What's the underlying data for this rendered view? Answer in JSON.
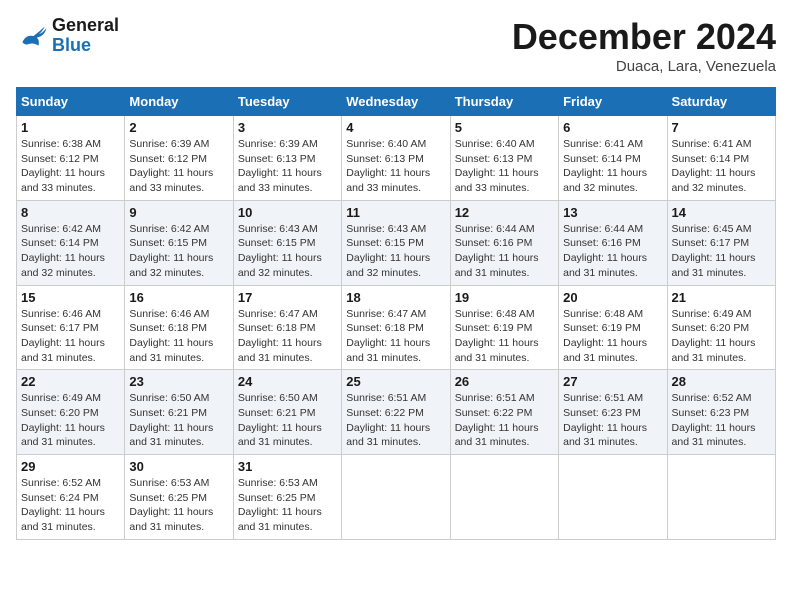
{
  "header": {
    "logo_line1": "General",
    "logo_line2": "Blue",
    "month_title": "December 2024",
    "subtitle": "Duaca, Lara, Venezuela"
  },
  "weekdays": [
    "Sunday",
    "Monday",
    "Tuesday",
    "Wednesday",
    "Thursday",
    "Friday",
    "Saturday"
  ],
  "weeks": [
    [
      {
        "day": "1",
        "sunrise": "6:38 AM",
        "sunset": "6:12 PM",
        "daylight": "11 hours and 33 minutes."
      },
      {
        "day": "2",
        "sunrise": "6:39 AM",
        "sunset": "6:12 PM",
        "daylight": "11 hours and 33 minutes."
      },
      {
        "day": "3",
        "sunrise": "6:39 AM",
        "sunset": "6:13 PM",
        "daylight": "11 hours and 33 minutes."
      },
      {
        "day": "4",
        "sunrise": "6:40 AM",
        "sunset": "6:13 PM",
        "daylight": "11 hours and 33 minutes."
      },
      {
        "day": "5",
        "sunrise": "6:40 AM",
        "sunset": "6:13 PM",
        "daylight": "11 hours and 33 minutes."
      },
      {
        "day": "6",
        "sunrise": "6:41 AM",
        "sunset": "6:14 PM",
        "daylight": "11 hours and 32 minutes."
      },
      {
        "day": "7",
        "sunrise": "6:41 AM",
        "sunset": "6:14 PM",
        "daylight": "11 hours and 32 minutes."
      }
    ],
    [
      {
        "day": "8",
        "sunrise": "6:42 AM",
        "sunset": "6:14 PM",
        "daylight": "11 hours and 32 minutes."
      },
      {
        "day": "9",
        "sunrise": "6:42 AM",
        "sunset": "6:15 PM",
        "daylight": "11 hours and 32 minutes."
      },
      {
        "day": "10",
        "sunrise": "6:43 AM",
        "sunset": "6:15 PM",
        "daylight": "11 hours and 32 minutes."
      },
      {
        "day": "11",
        "sunrise": "6:43 AM",
        "sunset": "6:15 PM",
        "daylight": "11 hours and 32 minutes."
      },
      {
        "day": "12",
        "sunrise": "6:44 AM",
        "sunset": "6:16 PM",
        "daylight": "11 hours and 31 minutes."
      },
      {
        "day": "13",
        "sunrise": "6:44 AM",
        "sunset": "6:16 PM",
        "daylight": "11 hours and 31 minutes."
      },
      {
        "day": "14",
        "sunrise": "6:45 AM",
        "sunset": "6:17 PM",
        "daylight": "11 hours and 31 minutes."
      }
    ],
    [
      {
        "day": "15",
        "sunrise": "6:46 AM",
        "sunset": "6:17 PM",
        "daylight": "11 hours and 31 minutes."
      },
      {
        "day": "16",
        "sunrise": "6:46 AM",
        "sunset": "6:18 PM",
        "daylight": "11 hours and 31 minutes."
      },
      {
        "day": "17",
        "sunrise": "6:47 AM",
        "sunset": "6:18 PM",
        "daylight": "11 hours and 31 minutes."
      },
      {
        "day": "18",
        "sunrise": "6:47 AM",
        "sunset": "6:18 PM",
        "daylight": "11 hours and 31 minutes."
      },
      {
        "day": "19",
        "sunrise": "6:48 AM",
        "sunset": "6:19 PM",
        "daylight": "11 hours and 31 minutes."
      },
      {
        "day": "20",
        "sunrise": "6:48 AM",
        "sunset": "6:19 PM",
        "daylight": "11 hours and 31 minutes."
      },
      {
        "day": "21",
        "sunrise": "6:49 AM",
        "sunset": "6:20 PM",
        "daylight": "11 hours and 31 minutes."
      }
    ],
    [
      {
        "day": "22",
        "sunrise": "6:49 AM",
        "sunset": "6:20 PM",
        "daylight": "11 hours and 31 minutes."
      },
      {
        "day": "23",
        "sunrise": "6:50 AM",
        "sunset": "6:21 PM",
        "daylight": "11 hours and 31 minutes."
      },
      {
        "day": "24",
        "sunrise": "6:50 AM",
        "sunset": "6:21 PM",
        "daylight": "11 hours and 31 minutes."
      },
      {
        "day": "25",
        "sunrise": "6:51 AM",
        "sunset": "6:22 PM",
        "daylight": "11 hours and 31 minutes."
      },
      {
        "day": "26",
        "sunrise": "6:51 AM",
        "sunset": "6:22 PM",
        "daylight": "11 hours and 31 minutes."
      },
      {
        "day": "27",
        "sunrise": "6:51 AM",
        "sunset": "6:23 PM",
        "daylight": "11 hours and 31 minutes."
      },
      {
        "day": "28",
        "sunrise": "6:52 AM",
        "sunset": "6:23 PM",
        "daylight": "11 hours and 31 minutes."
      }
    ],
    [
      {
        "day": "29",
        "sunrise": "6:52 AM",
        "sunset": "6:24 PM",
        "daylight": "11 hours and 31 minutes."
      },
      {
        "day": "30",
        "sunrise": "6:53 AM",
        "sunset": "6:25 PM",
        "daylight": "11 hours and 31 minutes."
      },
      {
        "day": "31",
        "sunrise": "6:53 AM",
        "sunset": "6:25 PM",
        "daylight": "11 hours and 31 minutes."
      },
      null,
      null,
      null,
      null
    ]
  ]
}
